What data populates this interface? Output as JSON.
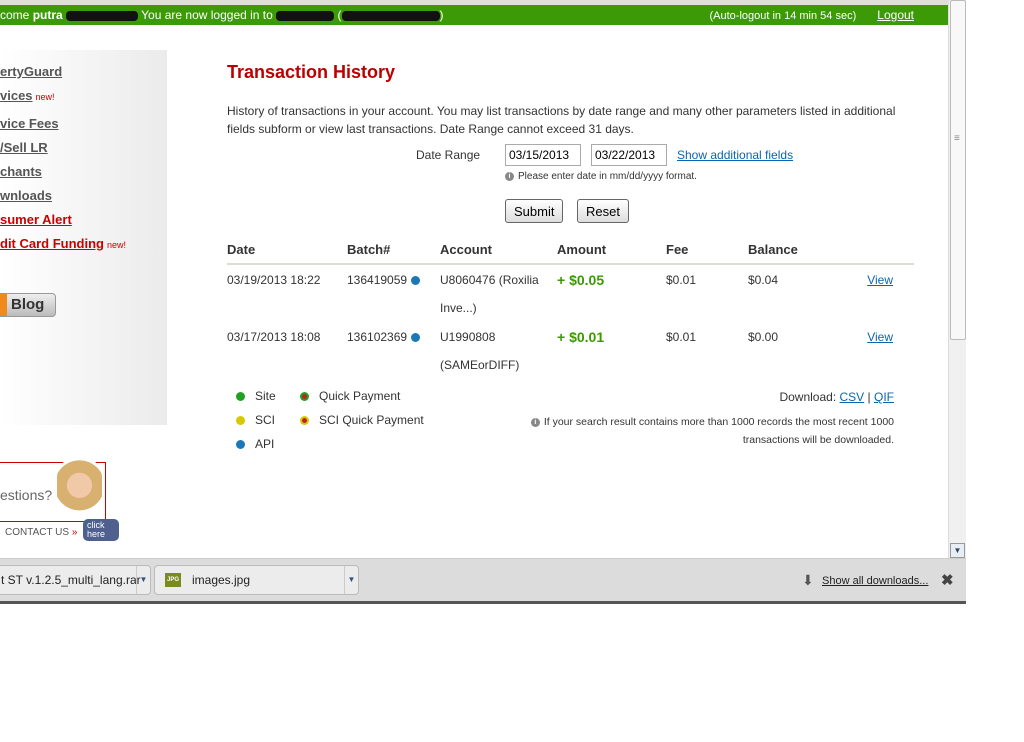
{
  "header": {
    "welcome_prefix": "come",
    "user_first": "putra",
    "logged_in_text": "You are now logged in to",
    "autologout": "(Auto-logout in 14 min 54 sec)",
    "logout_label": "Logout",
    "bar_color": "#3c9a06"
  },
  "sidebar": {
    "items": [
      {
        "label": "ertyGuard",
        "red": false
      },
      {
        "label": "vices",
        "red": false,
        "new": "new!"
      },
      {
        "label": "vice Fees",
        "red": false
      },
      {
        "label": "/Sell LR",
        "red": false
      },
      {
        "label": "chants",
        "red": false
      },
      {
        "label": "wnloads",
        "red": false
      },
      {
        "label": "sumer Alert",
        "red": true
      },
      {
        "label": "dit Card Funding",
        "red": true,
        "new": "new!"
      }
    ],
    "blog_label": "Blog",
    "contact": {
      "question": "estions?",
      "contact_us": "CONTACT US",
      "click_here": "click here"
    }
  },
  "main": {
    "title": "Transaction History",
    "description": "History of transactions in your account. You may list transactions by date range and many other parameters listed in additional fields subform or view last transactions. Date Range cannot exceed 31 days.",
    "date_range_label": "Date Range",
    "date_from": "03/15/2013",
    "date_to": "03/22/2013",
    "show_additional": "Show additional fields",
    "date_hint": "Please enter date in mm/dd/yyyy format.",
    "submit_label": "Submit",
    "reset_label": "Reset",
    "columns": [
      "Date",
      "Batch#",
      "Account",
      "Amount",
      "Fee",
      "Balance"
    ],
    "rows": [
      {
        "date": "03/19/2013 18:22",
        "batch": "136419059",
        "type": "API",
        "account": "U8060476 (Roxilia",
        "account2": "Inve...)",
        "amount": "+ $0.05",
        "fee": "$0.01",
        "balance": "$0.04",
        "view": "View"
      },
      {
        "date": "03/17/2013 18:08",
        "batch": "136102369",
        "type": "API",
        "account": "U1990808",
        "account2": "(SAMEorDIFF)",
        "amount": "+ $0.01",
        "fee": "$0.01",
        "balance": "$0.00",
        "view": "View"
      }
    ],
    "legend": [
      {
        "label": "Site",
        "color": "#22a022"
      },
      {
        "label": "Quick Payment",
        "color": "#22a022",
        "center": "#c02020"
      },
      {
        "label": "SCI",
        "color": "#d8c800"
      },
      {
        "label": "SCI Quick Payment",
        "color": "#d8c800",
        "center": "#c02020"
      },
      {
        "label": "API",
        "color": "#1a78b8"
      }
    ],
    "download_label": "Download:",
    "csv": "CSV",
    "sep": "|",
    "qif": "QIF",
    "download_note": "If your search result contains more than 1000 records the most recent 1000 transactions will be downloaded."
  },
  "downloads_bar": {
    "items": [
      "t ST v.1.2.5_multi_lang.rar",
      "images.jpg"
    ],
    "jpg_icon_text": "JPG",
    "show_all": "Show all downloads..."
  }
}
